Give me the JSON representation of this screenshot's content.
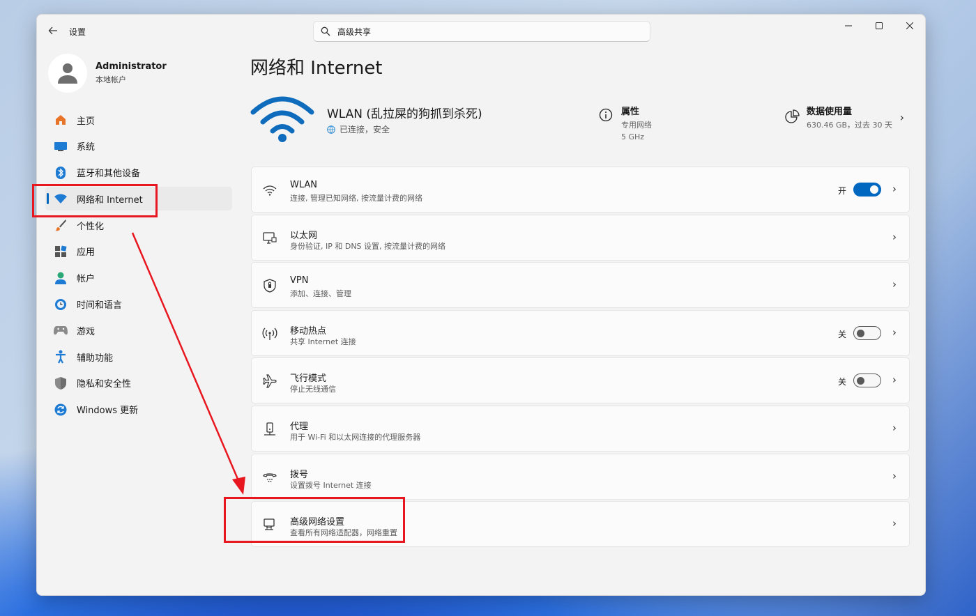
{
  "window": {
    "app_title": "设置",
    "search": {
      "value": "高级共享",
      "placeholder": ""
    }
  },
  "user": {
    "name": "Administrator",
    "account_type": "本地帐户"
  },
  "sidebar": {
    "items": [
      {
        "label": "主页",
        "icon": "home-icon"
      },
      {
        "label": "系统",
        "icon": "system-display-icon"
      },
      {
        "label": "蓝牙和其他设备",
        "icon": "bluetooth-icon"
      },
      {
        "label": "网络和 Internet",
        "icon": "wifi-icon",
        "active": true
      },
      {
        "label": "个性化",
        "icon": "paintbrush-icon"
      },
      {
        "label": "应用",
        "icon": "apps-icon"
      },
      {
        "label": "帐户",
        "icon": "person-icon"
      },
      {
        "label": "时间和语言",
        "icon": "globe-clock-icon"
      },
      {
        "label": "游戏",
        "icon": "gamepad-icon"
      },
      {
        "label": "辅助功能",
        "icon": "accessibility-icon"
      },
      {
        "label": "隐私和安全性",
        "icon": "shield-icon"
      },
      {
        "label": "Windows 更新",
        "icon": "update-icon"
      }
    ]
  },
  "main": {
    "title": "网络和 Internet",
    "wlan_hero": {
      "network_name": "WLAN (乱拉屎的狗抓到杀死)",
      "status": "已连接，安全",
      "properties_title": "属性",
      "properties_line1": "专用网络",
      "properties_line2": "5 GHz",
      "usage_title": "数据使用量",
      "usage_detail": "630.46 GB，过去 30 天"
    },
    "cards": [
      {
        "title": "WLAN",
        "subtitle": "连接, 管理已知网络, 按流量计费的网络",
        "icon": "wifi-icon",
        "toggle_label": "开",
        "toggle_on": true
      },
      {
        "title": "以太网",
        "subtitle": "身份验证, IP 和 DNS 设置, 按流量计费的网络",
        "icon": "ethernet-icon"
      },
      {
        "title": "VPN",
        "subtitle": "添加、连接、管理",
        "icon": "vpn-shield-icon"
      },
      {
        "title": "移动热点",
        "subtitle": "共享 Internet 连接",
        "icon": "hotspot-icon",
        "toggle_label": "关",
        "toggle_on": false
      },
      {
        "title": "飞行模式",
        "subtitle": "停止无线通信",
        "icon": "airplane-icon",
        "toggle_label": "关",
        "toggle_on": false
      },
      {
        "title": "代理",
        "subtitle": "用于 Wi-Fi 和以太网连接的代理服务器",
        "icon": "proxy-icon"
      },
      {
        "title": "拨号",
        "subtitle": "设置拨号 Internet 连接",
        "icon": "dialup-icon"
      },
      {
        "title": "高级网络设置",
        "subtitle": "查看所有网络适配器，网络重置",
        "icon": "network-adapter-icon"
      }
    ]
  },
  "colors": {
    "accent": "#0067c0",
    "annotation": "#e8161f"
  }
}
